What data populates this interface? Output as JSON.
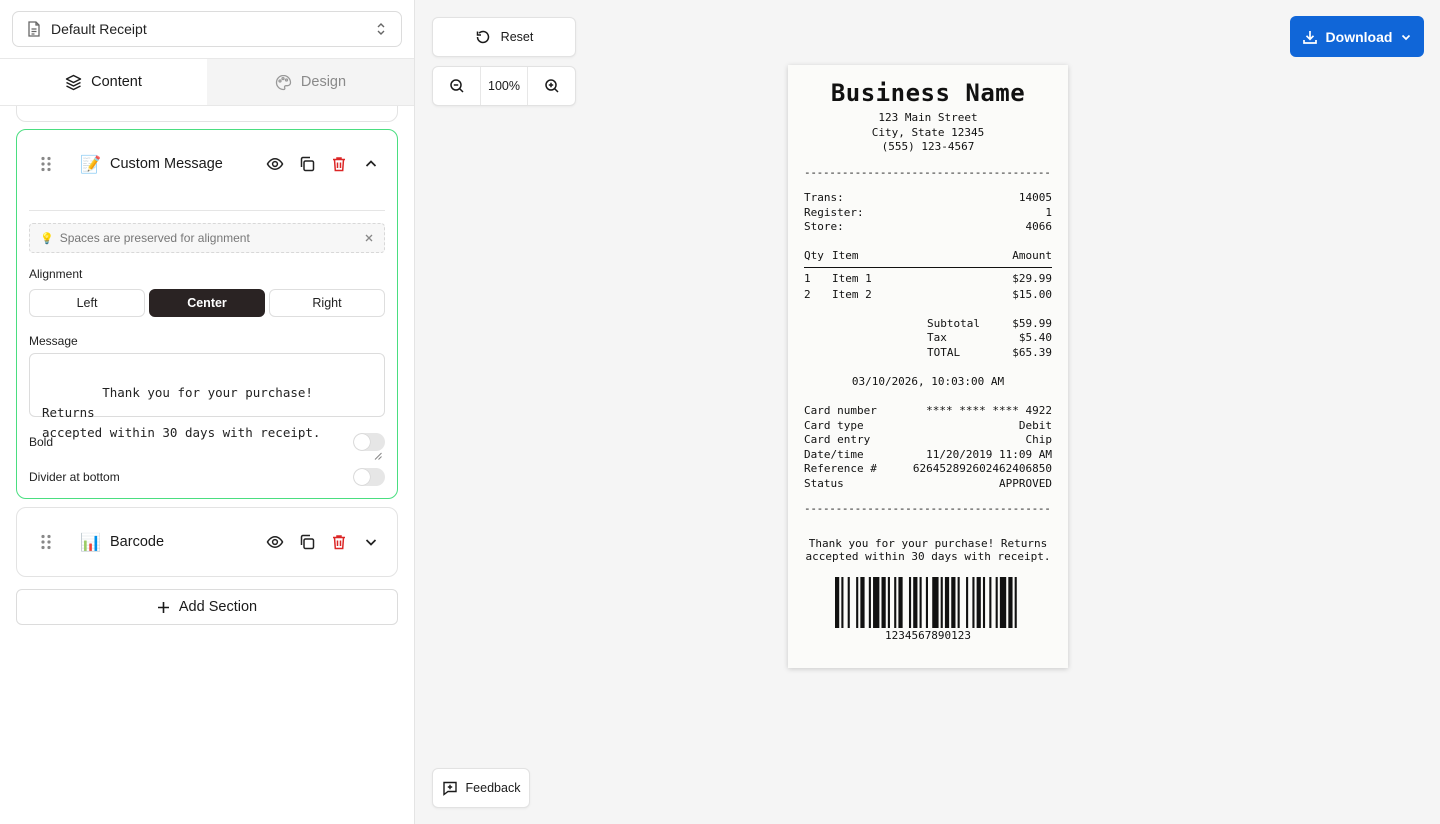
{
  "template": {
    "selected": "Default Receipt"
  },
  "tabs": [
    {
      "label": "Content"
    },
    {
      "label": "Design"
    }
  ],
  "sections": [
    {
      "emoji": "📝",
      "title": "Custom Message",
      "tip": "Spaces are preserved for alignment",
      "alignment_label": "Alignment",
      "alignment_options": [
        "Left",
        "Center",
        "Right"
      ],
      "alignment_selected": "Center",
      "message_label": "Message",
      "message": "Thank you for your purchase! Returns\naccepted within 30 days with receipt.",
      "bold_label": "Bold",
      "bold": false,
      "divider_label": "Divider at bottom",
      "divider": false
    },
    {
      "emoji": "📊",
      "title": "Barcode"
    }
  ],
  "add_section_label": "Add Section",
  "canvas": {
    "reset_label": "Reset",
    "zoom": "100%",
    "download_label": "Download",
    "feedback_label": "Feedback"
  },
  "receipt": {
    "business_name": "Business Name",
    "address": "123 Main Street",
    "city": "City, State 12345",
    "phone": "(555) 123-4567",
    "divider": "----------------------------------------",
    "meta": [
      {
        "label": "Trans:",
        "value": "14005"
      },
      {
        "label": "Register:",
        "value": "1"
      },
      {
        "label": "Store:",
        "value": "4066"
      }
    ],
    "items_header": {
      "qty": "Qty",
      "item": "Item",
      "amount": "Amount"
    },
    "items": [
      {
        "qty": "1",
        "name": "Item 1",
        "amount": "$29.99"
      },
      {
        "qty": "2",
        "name": "Item 2",
        "amount": "$15.00"
      }
    ],
    "totals": [
      {
        "label": "Subtotal",
        "value": "$59.99"
      },
      {
        "label": "Tax",
        "value": "$5.40"
      },
      {
        "label": "TOTAL",
        "value": "$65.39"
      }
    ],
    "datetime": "03/10/2026, 10:03:00 AM",
    "payment": [
      {
        "label": "Card number",
        "value": "**** **** **** 4922"
      },
      {
        "label": "Card type",
        "value": "Debit"
      },
      {
        "label": "Card entry",
        "value": "Chip"
      },
      {
        "label": "Date/time",
        "value": "11/20/2019 11:09 AM"
      },
      {
        "label": "Reference #",
        "value": "626452892602462406850"
      },
      {
        "label": "Status",
        "value": "APPROVED"
      }
    ],
    "message_line1": "Thank you for your purchase! Returns",
    "message_line2": "accepted within 30 days with receipt.",
    "barcode_value": "1234567890123"
  },
  "colors": {
    "accent": "#1066d8",
    "selected_button": "#2a2323",
    "active_border": "#4ade80",
    "delete": "#dc2626"
  },
  "icons": [
    "file-icon",
    "chevron-up-down-icon",
    "layers-icon",
    "palette-icon",
    "drag-handle-icon",
    "eye-icon",
    "copy-icon",
    "trash-icon",
    "chevron-up-icon",
    "chevron-down-icon",
    "lightbulb-icon",
    "close-icon",
    "plus-icon",
    "reset-icon",
    "zoom-out-icon",
    "zoom-in-icon",
    "download-icon",
    "feedback-icon"
  ]
}
